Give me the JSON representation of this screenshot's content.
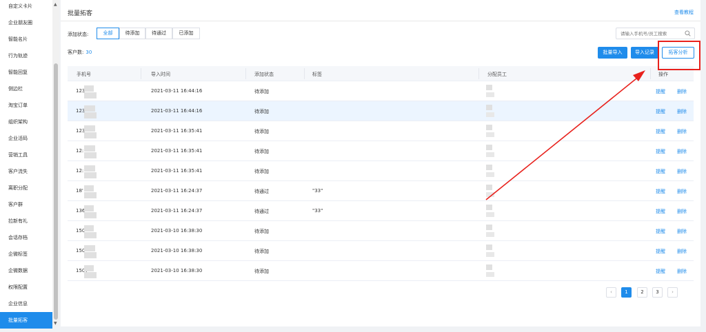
{
  "sidebar": {
    "items": [
      {
        "label": "自定义卡片"
      },
      {
        "label": "企业朋友圈"
      },
      {
        "label": "智能名片"
      },
      {
        "label": "行为轨迹"
      },
      {
        "label": "智能回复"
      },
      {
        "label": "侧边栏"
      },
      {
        "label": "淘宝订单"
      },
      {
        "label": "组织架构"
      },
      {
        "label": "企业活码"
      },
      {
        "label": "营销工具"
      },
      {
        "label": "客户流失"
      },
      {
        "label": "离职分配"
      },
      {
        "label": "客户群"
      },
      {
        "label": "拉新有礼"
      },
      {
        "label": "会话存档"
      },
      {
        "label": "企微标签"
      },
      {
        "label": "企微数据"
      },
      {
        "label": "权限配置"
      },
      {
        "label": "企业信息"
      },
      {
        "label": "批量拓客"
      }
    ],
    "active_index": 19
  },
  "header": {
    "title": "批量拓客",
    "tutorial_link": "查看教程"
  },
  "filter": {
    "label": "添加状态:",
    "options": [
      {
        "label": "全部"
      },
      {
        "label": "待添加"
      },
      {
        "label": "待通过"
      },
      {
        "label": "已添加"
      }
    ],
    "selected_index": 0
  },
  "search": {
    "placeholder": "请输入手机号/员工搜索",
    "value": ""
  },
  "summary": {
    "count_label": "客户数:",
    "count_value": "30"
  },
  "actions": {
    "batch_import": "批量导入",
    "import_records": "导入记录",
    "analysis": "拓客分析"
  },
  "table": {
    "headers": {
      "phone": "手机号",
      "import_time": "导入时间",
      "status": "添加状态",
      "tag": "标签",
      "staff": "分配员工",
      "ops": "操作"
    },
    "rows": [
      {
        "phone": "123",
        "time": "2021-03-11 16:44:16",
        "status": "待添加",
        "tag": "",
        "remind": "提醒",
        "delete": "删除"
      },
      {
        "phone": "123",
        "time": "2021-03-11 16:44:16",
        "status": "待添加",
        "tag": "",
        "remind": "提醒",
        "delete": "删除"
      },
      {
        "phone": "123",
        "time": "2021-03-11 16:35:41",
        "status": "待添加",
        "tag": "",
        "remind": "提醒",
        "delete": "删除"
      },
      {
        "phone": "12:",
        "time": "2021-03-11 16:35:41",
        "status": "待添加",
        "tag": "",
        "remind": "提醒",
        "delete": "删除"
      },
      {
        "phone": "12:",
        "time": "2021-03-11 16:35:41",
        "status": "待添加",
        "tag": "",
        "remind": "提醒",
        "delete": "删除"
      },
      {
        "phone": "18'",
        "time": "2021-03-11 16:24:37",
        "status": "待通过",
        "tag": "\"33\"",
        "remind": "提醒",
        "delete": "删除"
      },
      {
        "phone": "136",
        "time": "2021-03-11 16:24:37",
        "status": "待通过",
        "tag": "\"33\"",
        "remind": "提醒",
        "delete": "删除"
      },
      {
        "phone": "150",
        "time": "2021-03-10 16:38:30",
        "status": "待添加",
        "tag": "",
        "remind": "提醒",
        "delete": "删除"
      },
      {
        "phone": "150",
        "time": "2021-03-10 16:38:30",
        "status": "待添加",
        "tag": "",
        "remind": "提醒",
        "delete": "删除"
      },
      {
        "phone": "1507",
        "time": "2021-03-10 16:38:30",
        "status": "待添加",
        "tag": "",
        "remind": "提醒",
        "delete": "删除"
      }
    ],
    "highlighted_row": 1
  },
  "pagination": {
    "prev": "‹",
    "pages": [
      "1",
      "2",
      "3"
    ],
    "current": "1",
    "next": "›"
  },
  "annotation": {
    "color": "#e8211c"
  },
  "colors": {
    "accent": "#1f8ceb"
  }
}
